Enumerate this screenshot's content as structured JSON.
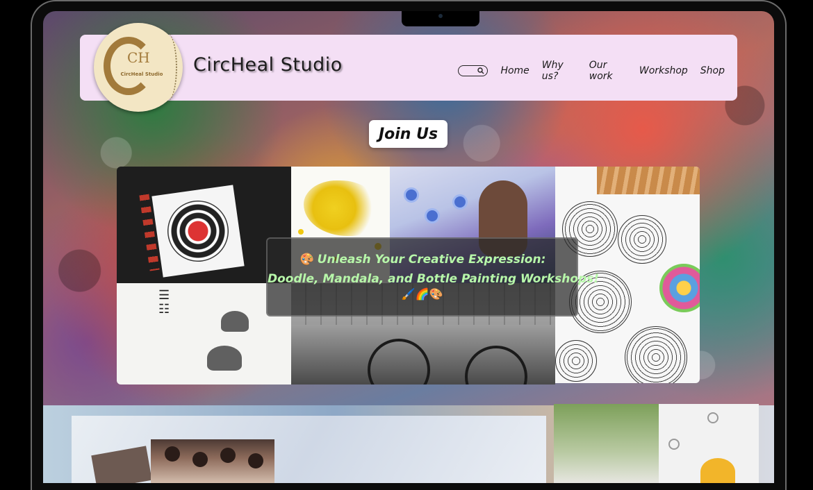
{
  "site": {
    "brand": "CircHeal Studio",
    "logo_text": "CircHeal Studio",
    "logo_monogram": "CH"
  },
  "nav": {
    "items": [
      {
        "label": "Home"
      },
      {
        "label": "Why us?"
      },
      {
        "label": "Our work"
      },
      {
        "label": "Workshop"
      },
      {
        "label": "Shop"
      }
    ]
  },
  "hero": {
    "join_label": "Join Us",
    "tagline_line1": "🎨 Unleash Your Creative Expression:",
    "tagline_line2": "Doodle, Mandala, and Bottle Painting Workshops!",
    "tagline_line3": "🖌️🌈🎨"
  },
  "colors": {
    "header_bg": "#f4dff5",
    "tagline": "#b7f7a9",
    "logo_gold": "#a27a3b"
  }
}
